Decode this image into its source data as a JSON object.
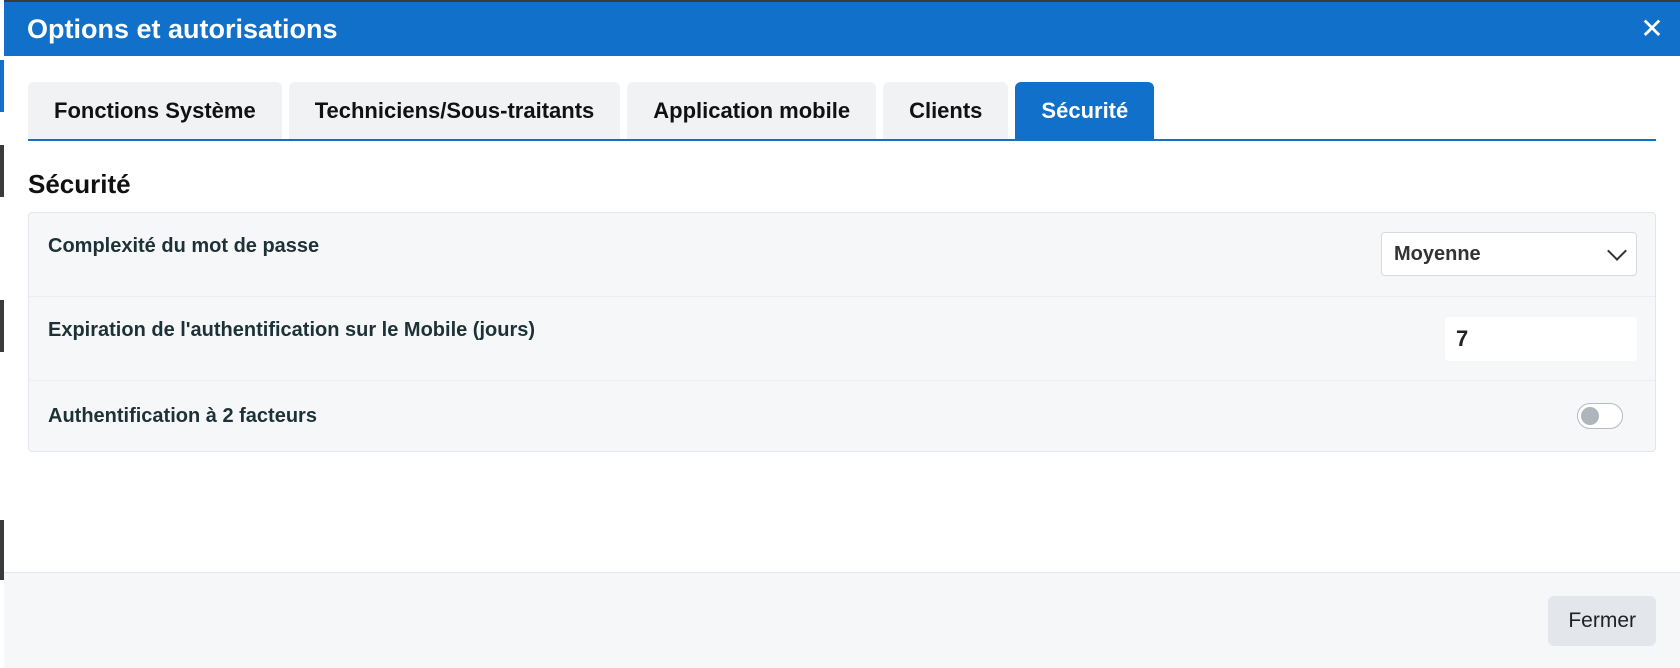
{
  "modal": {
    "title": "Options et autorisations",
    "close_symbol": "✕"
  },
  "tabs": [
    {
      "label": "Fonctions Système",
      "active": false
    },
    {
      "label": "Techniciens/Sous-traitants",
      "active": false
    },
    {
      "label": "Application mobile",
      "active": false
    },
    {
      "label": "Clients",
      "active": false
    },
    {
      "label": "Sécurité",
      "active": true
    }
  ],
  "section": {
    "title": "Sécurité"
  },
  "settings": {
    "password_complexity": {
      "label": "Complexité du mot de passe",
      "value": "Moyenne"
    },
    "mobile_auth_expiration": {
      "label": "Expiration de l'authentification sur le Mobile (jours)",
      "value": "7"
    },
    "two_factor": {
      "label": "Authentification à 2 facteurs",
      "enabled": false
    }
  },
  "footer": {
    "close_label": "Fermer"
  },
  "colors": {
    "accent": "#1170c9",
    "panel_bg": "#f6f7f9",
    "label_text": "#1d3238"
  },
  "icons": {
    "close": "close-icon",
    "dropdown": "chevron-down-icon"
  }
}
